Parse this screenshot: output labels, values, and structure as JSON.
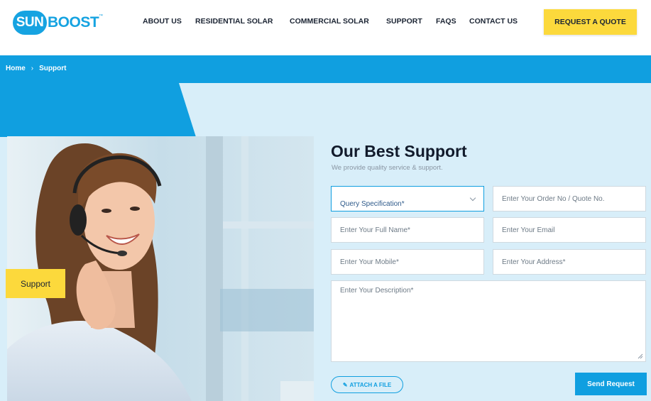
{
  "brand": {
    "logo_sun": "SUN",
    "logo_boost": "BOOST",
    "accent": "#16a3e1",
    "yellow": "#fcd93c"
  },
  "nav": {
    "items": [
      "ABOUT US",
      "RESIDENTIAL SOLAR",
      "COMMERCIAL SOLAR",
      "SUPPORT",
      "FAQS",
      "CONTACT US"
    ],
    "cta": "REQUEST A QUOTE"
  },
  "breadcrumb": {
    "home": "Home",
    "separator": "›",
    "current": "Support"
  },
  "hero": {
    "tab_label": "Support",
    "photo": "support agent with headset smiling"
  },
  "form": {
    "title": "Our Best Support",
    "subtitle": "We provide quality service & support.",
    "query_select": "Query Specification*",
    "order_placeholder": "Enter Your Order No / Quote No.",
    "name_placeholder": "Enter Your Full Name*",
    "email_placeholder": "Enter Your Email",
    "mobile_placeholder": "Enter Your Mobile*",
    "address_placeholder": "Enter Your Address*",
    "description_placeholder": "Enter Your Description*",
    "attach_label": "ATTACH A FILE",
    "submit_label": "Send Request"
  }
}
